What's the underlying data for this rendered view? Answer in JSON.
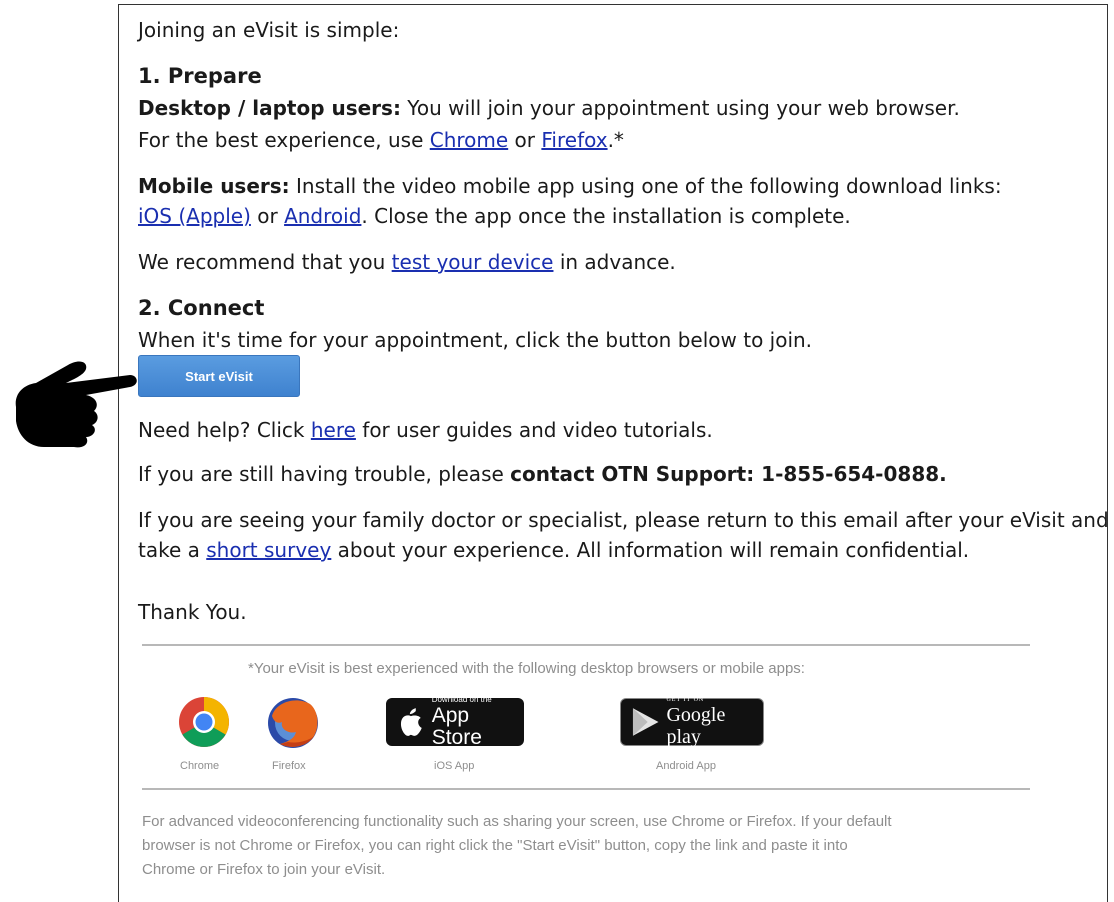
{
  "intro": "Joining an eVisit is simple:",
  "prepare": {
    "heading": "1. Prepare",
    "desktop_label": "Desktop / laptop users:",
    "desktop_text": " You will join your appointment using your web browser.",
    "best_pre": "For the best experience, use ",
    "chrome_link": "Chrome",
    "or1": " or ",
    "firefox_link": "Firefox",
    "best_post": ".*",
    "mobile_label": "Mobile users:",
    "mobile_text": " Install the video mobile app using one of the following download links:",
    "ios_link": "iOS (Apple)",
    "or2": " or ",
    "android_link": "Android",
    "mobile_post": ". Close the app once the installation is complete.",
    "recommend_pre": "We recommend that you ",
    "test_link": "test your device",
    "recommend_post": " in advance."
  },
  "connect": {
    "heading": "2. Connect",
    "text": "When it's time for your appointment, click the button below to join.",
    "button": "Start eVisit"
  },
  "help": {
    "pre": "Need help? Click ",
    "link": "here",
    "post": " for user guides and video tutorials."
  },
  "trouble": {
    "pre": "If you are still having trouble, please ",
    "bold": "contact OTN Support: 1-855-654-0888."
  },
  "survey": {
    "line1": "If you are seeing your family doctor or specialist, please return to this email after your eVisit and",
    "pre": "take a ",
    "link": "short survey",
    "post": " about your experience. All information will remain confidential."
  },
  "thanks": "Thank You.",
  "browsers": {
    "note": "*Your eVisit is best experienced with the following desktop browsers or mobile apps:",
    "chrome": "Chrome",
    "firefox": "Firefox",
    "ios": "iOS App",
    "android": "Android App",
    "appstore_small": "Download on the",
    "appstore_big": "App Store",
    "gplay_small": "GET IT ON",
    "gplay_big": "Google play"
  },
  "footer": {
    "line1": "For advanced videoconferencing functionality such as sharing your screen, use Chrome or Firefox. If your default",
    "line2": "browser is not Chrome or Firefox, you can right click the \"Start eVisit\" button, copy the link and paste it into",
    "line3": "Chrome or Firefox to join your eVisit."
  },
  "colors": {
    "link": "#1a2fb0",
    "button": "#4a8fd8"
  }
}
